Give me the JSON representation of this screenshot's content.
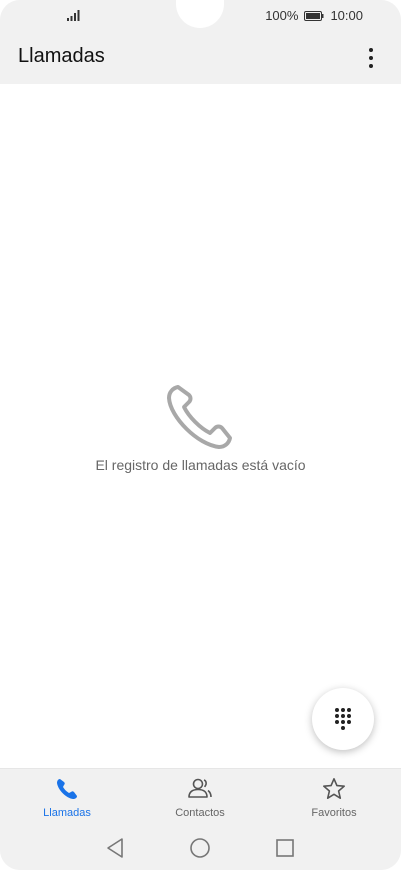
{
  "status_bar": {
    "battery_text": "100%",
    "time": "10:00"
  },
  "app_bar": {
    "title": "Llamadas",
    "more_icon": "more-vertical-icon"
  },
  "empty_state": {
    "icon": "phone-icon",
    "message": "El registro de llamadas está vacío"
  },
  "fab": {
    "icon": "dialpad-icon"
  },
  "bottom_nav": {
    "items": [
      {
        "label": "Llamadas",
        "icon": "phone-icon",
        "active": true
      },
      {
        "label": "Contactos",
        "icon": "contacts-icon",
        "active": false
      },
      {
        "label": "Favoritos",
        "icon": "star-icon",
        "active": false
      }
    ],
    "active_color": "#1a73e8"
  },
  "system_nav": {
    "icons": [
      "back-icon",
      "home-icon",
      "recents-icon"
    ]
  }
}
